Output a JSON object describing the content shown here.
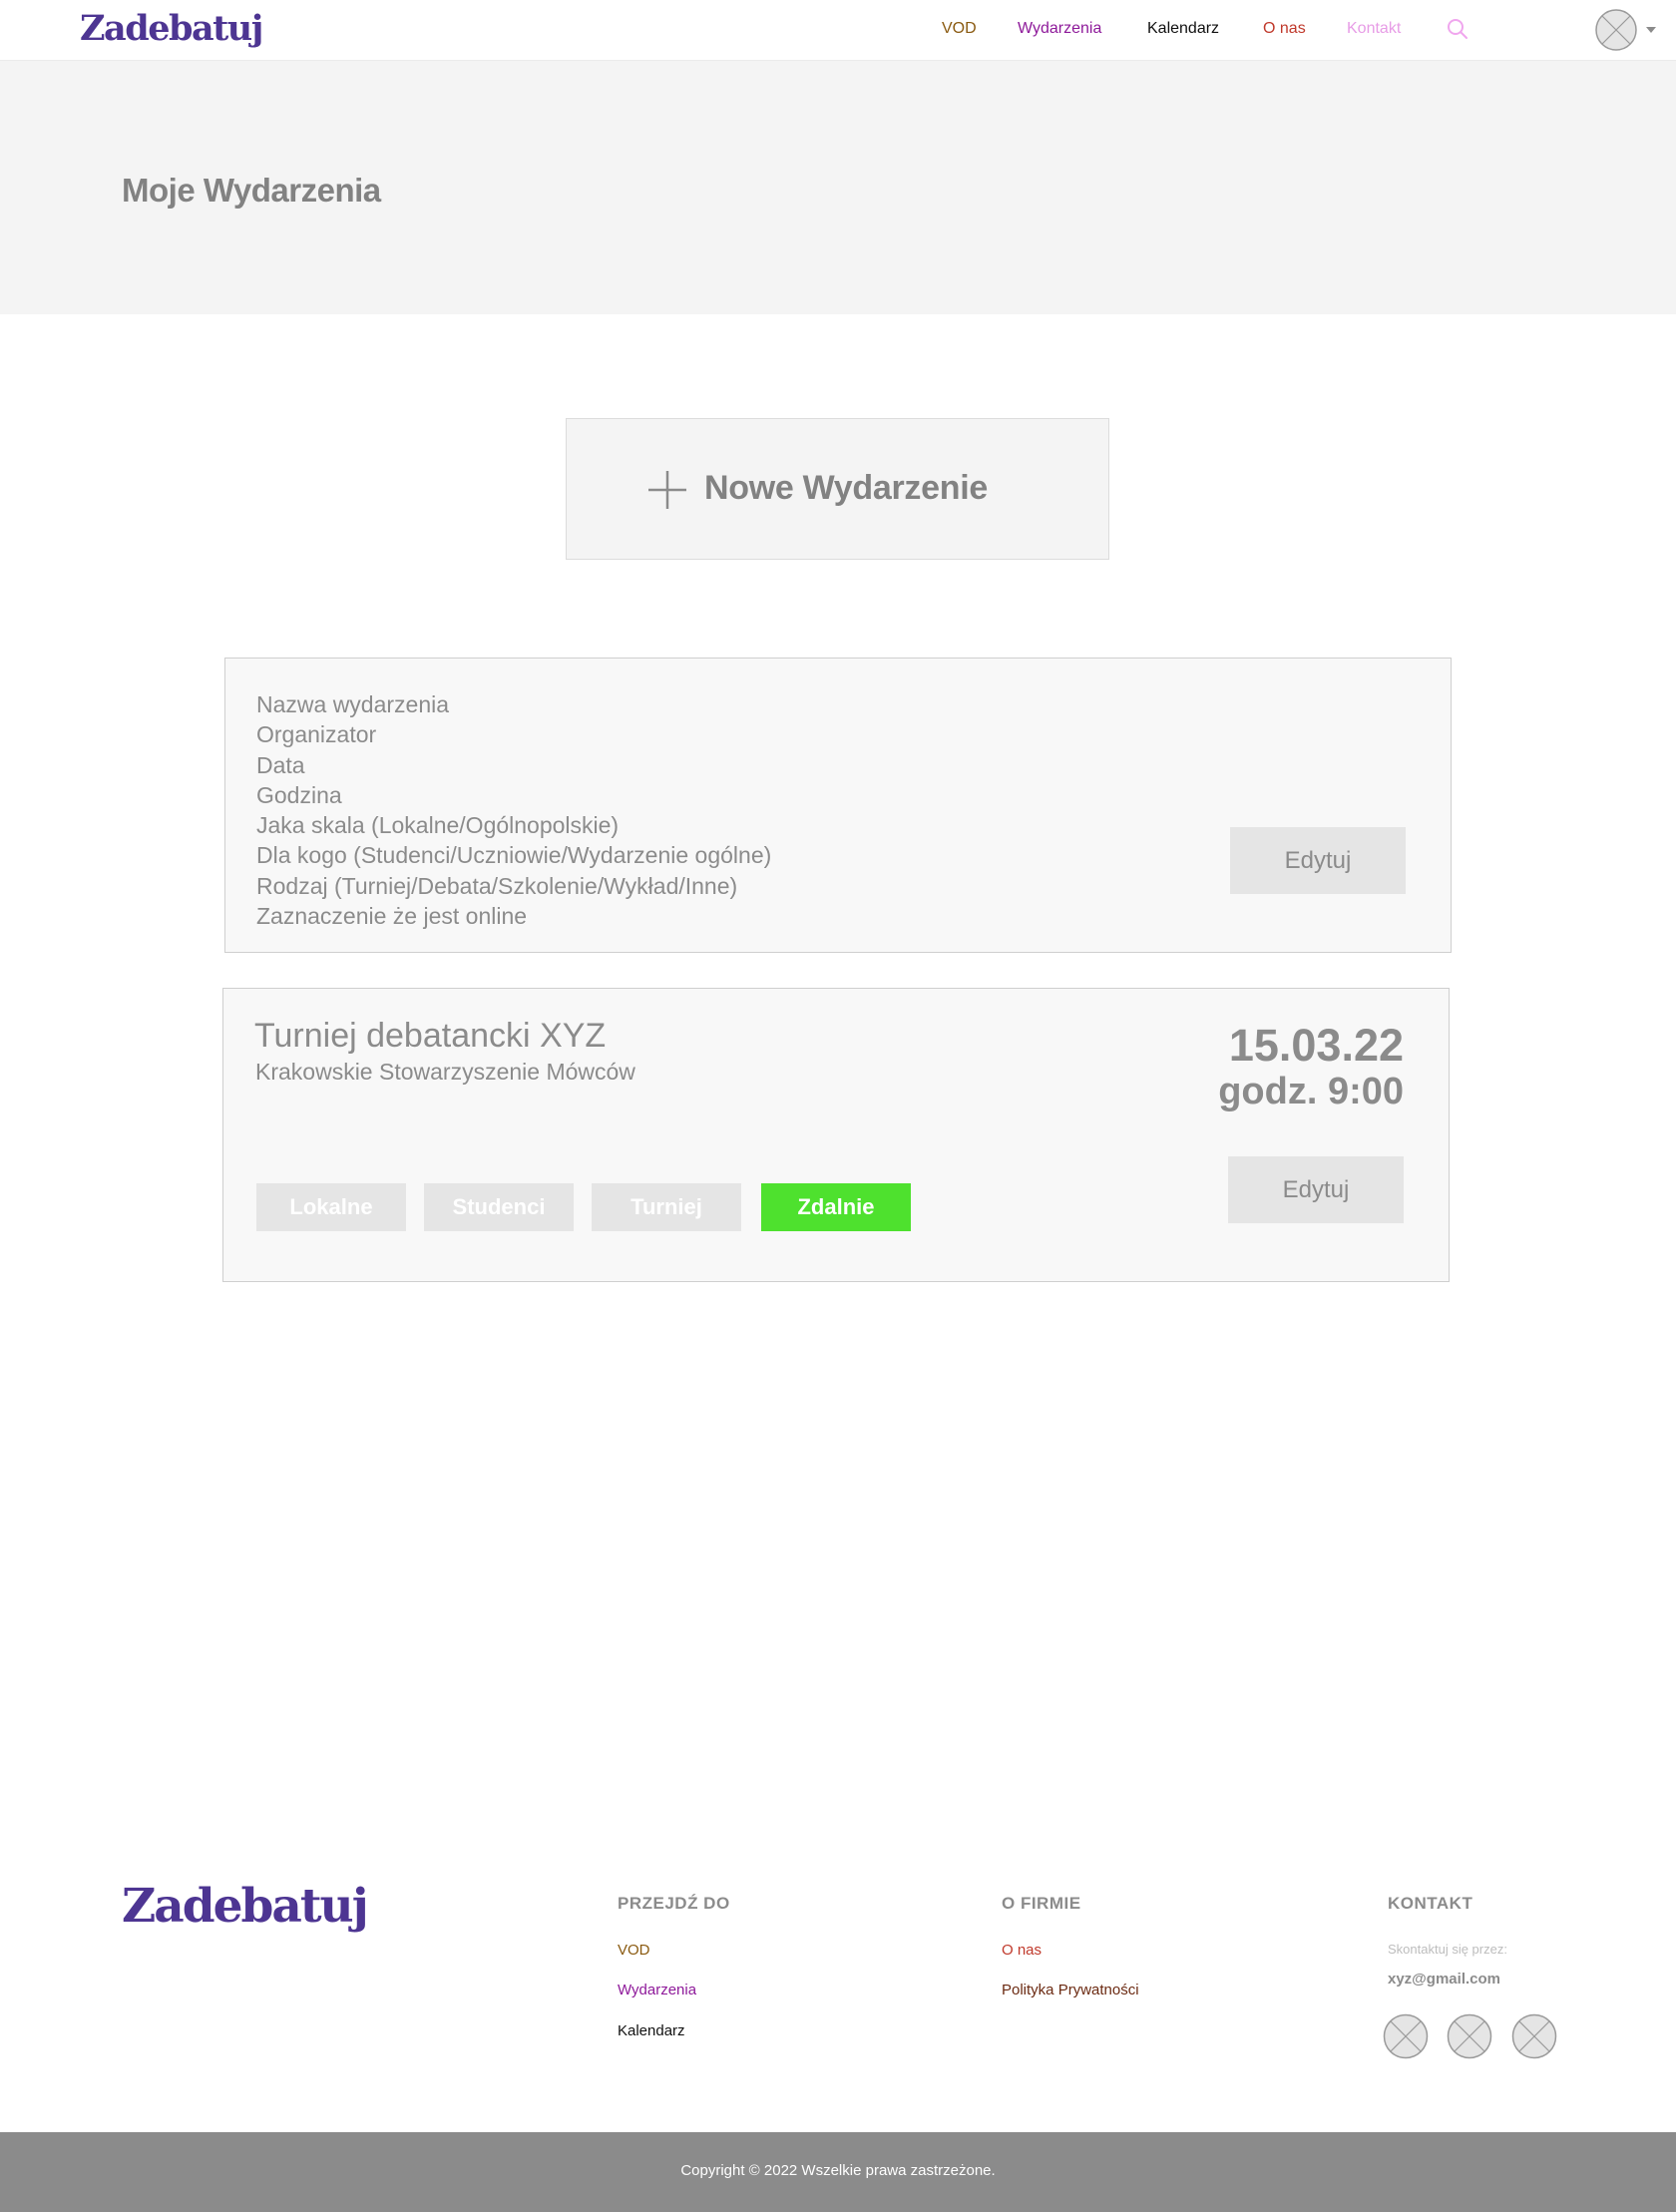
{
  "header": {
    "logo": "Zadebatuj",
    "nav": [
      {
        "label": "VOD",
        "color": "#8a5a10"
      },
      {
        "label": "Wydarzenia",
        "color": "#8e1a9a"
      },
      {
        "label": "Kalendarz",
        "color": "#111111"
      },
      {
        "label": "O nas",
        "color": "#c0392b"
      },
      {
        "label": "Kontakt",
        "color": "#e79ce6"
      }
    ],
    "search_icon": "search-icon",
    "search_color": "#f0a6ee",
    "avatar_icon": "avatar-placeholder-icon"
  },
  "hero": {
    "title": "Moje Wydarzenia"
  },
  "new_event": {
    "label": "Nowe  Wydarzenie",
    "icon": "plus-icon"
  },
  "template_card": {
    "fields": [
      "Nazwa wydarzenia",
      "Organizator",
      "Data",
      "Godzina",
      "Jaka skala (Lokalne/Ogólnopolskie)",
      "Dla kogo (Studenci/Uczniowie/Wydarzenie ogólne)",
      "Rodzaj (Turniej/Debata/Szkolenie/Wykład/Inne)",
      "Zaznaczenie że jest online"
    ],
    "edit_label": "Edytuj"
  },
  "event_card": {
    "name": "Turniej debatancki XYZ",
    "organizer": "Krakowskie Stowarzyszenie Mówców",
    "date": "15.03.22",
    "time": "godz. 9:00",
    "tags": [
      {
        "label": "Lokalne",
        "active": false
      },
      {
        "label": "Studenci",
        "active": false
      },
      {
        "label": "Turniej",
        "active": false
      },
      {
        "label": "Zdalnie",
        "active": true
      }
    ],
    "active_tag_color": "#4ee12e",
    "edit_label": "Edytuj"
  },
  "footer": {
    "logo": "Zadebatuj",
    "columns": [
      {
        "heading": "PRZEJDŹ DO",
        "links": [
          {
            "label": "VOD",
            "color": "#8a5a10"
          },
          {
            "label": "Wydarzenia",
            "color": "#8e1a9a"
          },
          {
            "label": "Kalendarz",
            "color": "#111111"
          }
        ]
      },
      {
        "heading": "O FIRMIE",
        "links": [
          {
            "label": "O nas",
            "color": "#c0392b"
          },
          {
            "label": "Polityka Prywatności",
            "color": "#6b2a12"
          }
        ]
      },
      {
        "heading": "KONTAKT",
        "contact_prompt": "Skontaktuj się przez:",
        "email": "xyz@gmail.com",
        "social_icons": [
          "social-placeholder-icon",
          "social-placeholder-icon",
          "social-placeholder-icon"
        ]
      }
    ],
    "copyright": "Copyright © 2022 Wszelkie prawa zastrzeżone."
  }
}
